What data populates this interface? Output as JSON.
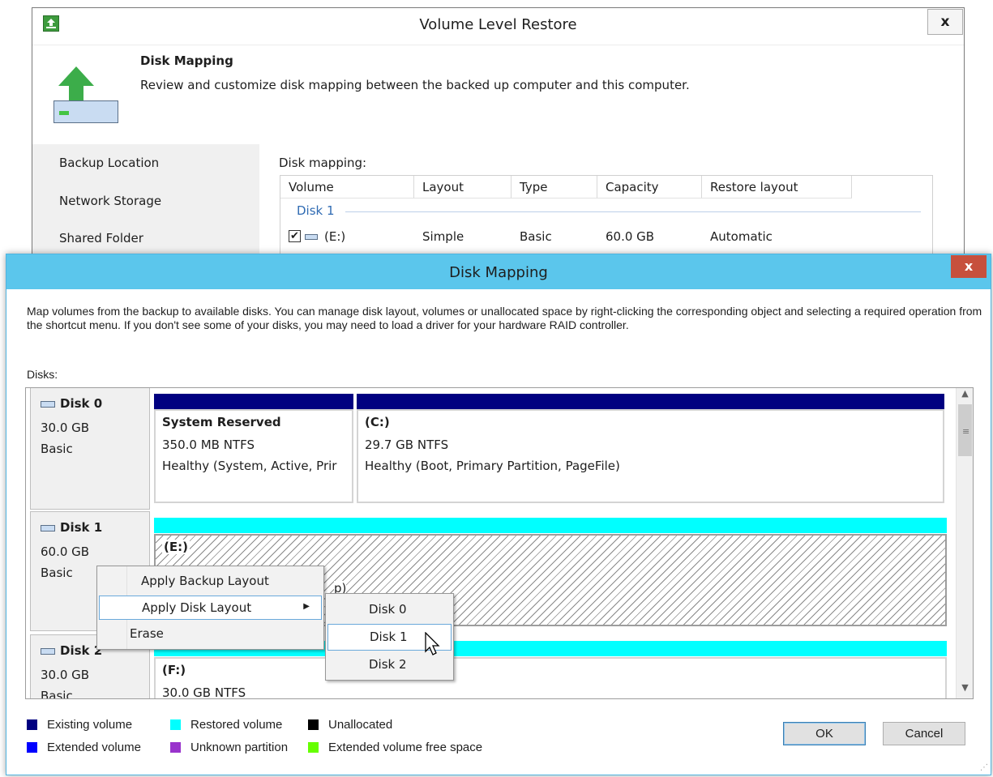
{
  "back_window": {
    "title": "Volume Level Restore",
    "close_label": "x",
    "header_title": "Disk Mapping",
    "header_desc": "Review and customize disk mapping between the backed up computer and this computer.",
    "nav": [
      "Backup Location",
      "Network Storage",
      "Shared Folder"
    ],
    "mapping_label": "Disk mapping:",
    "columns": [
      "Volume",
      "Layout",
      "Type",
      "Capacity",
      "Restore layout"
    ],
    "group": "Disk 1",
    "row": {
      "check": "✔",
      "volume": "(E:)",
      "layout": "Simple",
      "type": "Basic",
      "capacity": "60.0 GB",
      "restore_layout": "Automatic"
    }
  },
  "dialog": {
    "title": "Disk Mapping",
    "close_label": "x",
    "description": "Map volumes from the backup to available disks. You can manage disk layout, volumes or unallocated space by right-clicking the corresponding object and selecting a required operation from the shortcut menu. If you don't see some of your disks, you may need to load a driver for your hardware RAID controller.",
    "disks_label": "Disks:",
    "disks": [
      {
        "name": "Disk 0",
        "size": "30.0 GB",
        "type": "Basic",
        "partitions": [
          {
            "name": "System Reserved",
            "fs": "350.0 MB NTFS",
            "status": "Healthy (System, Active, Prir"
          },
          {
            "name": "(C:)",
            "fs": "29.7 GB NTFS",
            "status": "Healthy (Boot, Primary Partition, PageFile)"
          }
        ]
      },
      {
        "name": "Disk 1",
        "size": "60.0 GB",
        "type": "Basic",
        "partitions": [
          {
            "name": "(E:)",
            "fs": "",
            "status": "p)"
          }
        ]
      },
      {
        "name": "Disk 2",
        "size": "30.0 GB",
        "type": "Basic",
        "partitions": [
          {
            "name": "(F:)",
            "fs": "30.0 GB NTFS",
            "status": ""
          }
        ]
      }
    ],
    "legend": [
      {
        "label": "Existing volume",
        "color": "#000080"
      },
      {
        "label": "Restored volume",
        "color": "#00ffff"
      },
      {
        "label": "Unallocated",
        "color": "#000000"
      },
      {
        "label": "Extended volume",
        "color": "#0000ff"
      },
      {
        "label": "Unknown partition",
        "color": "#9933cc"
      },
      {
        "label": "Extended volume free space",
        "color": "#66ff00"
      }
    ],
    "ok_label": "OK",
    "cancel_label": "Cancel"
  },
  "context_menu": {
    "items": [
      "Apply Backup Layout",
      "Apply Disk Layout",
      "Erase"
    ],
    "submenu_arrow": "▶",
    "submenu": [
      "Disk 0",
      "Disk 1",
      "Disk 2"
    ]
  },
  "colors": {
    "existing_volume": "#000080",
    "restored_volume": "#00ffff",
    "titlebar_active": "#5bc6ec",
    "close_button": "#c7503d"
  }
}
